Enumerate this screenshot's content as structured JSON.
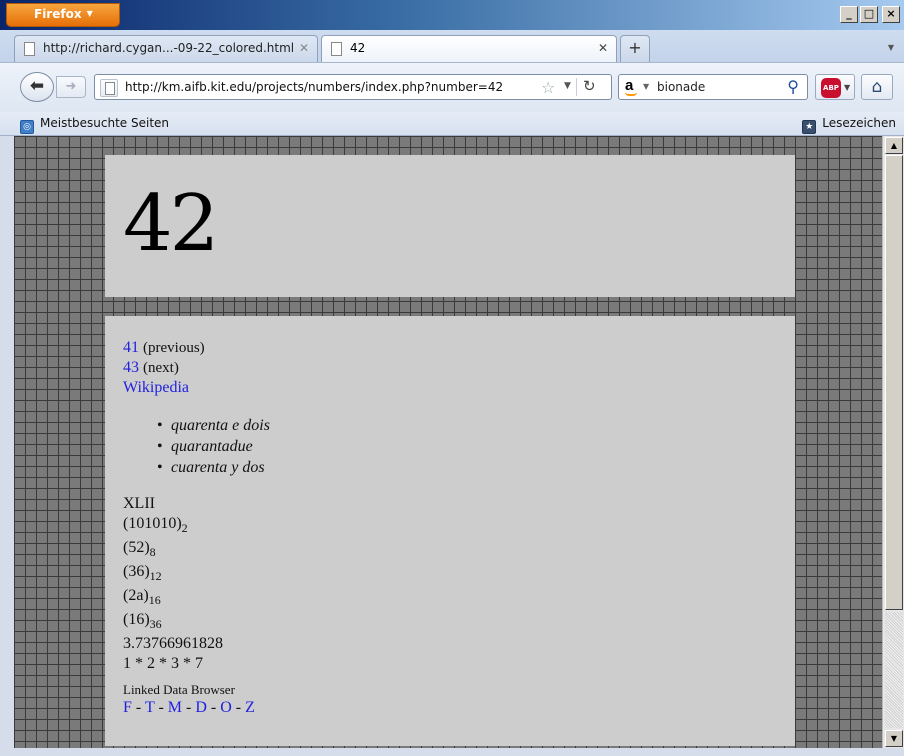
{
  "browser": {
    "menu_button": "Firefox",
    "window_controls": {
      "minimize": "_",
      "maximize": "□",
      "close": "×"
    },
    "tabs": [
      {
        "title": "http://richard.cygan...-09-22_colored.html",
        "active": false
      },
      {
        "title": "42",
        "active": true
      }
    ],
    "new_tab_label": "+",
    "url": "http://km.aifb.kit.edu/projects/numbers/index.php?number=42",
    "search": {
      "engine": "a",
      "query": "bionade"
    },
    "bookmarks_toolbar": {
      "left_item": "Meistbesuchte Seiten",
      "right_item": "Lesezeichen"
    }
  },
  "page": {
    "number": "42",
    "prev": {
      "link": "41",
      "label": "(previous)"
    },
    "next": {
      "link": "43",
      "label": "(next)"
    },
    "wikipedia": "Wikipedia",
    "translations": [
      "quarenta e dois",
      "quarantadue",
      "cuarenta y dos"
    ],
    "roman": "XLII",
    "bases": [
      {
        "value": "(101010)",
        "base": "2"
      },
      {
        "value": "(52)",
        "base": "8"
      },
      {
        "value": "(36)",
        "base": "12"
      },
      {
        "value": "(2a)",
        "base": "16"
      },
      {
        "value": "(16)",
        "base": "36"
      }
    ],
    "sqrt_text": "3.73766961828",
    "factorization": "1 * 2 * 3 * 7",
    "ldb_label": "Linked Data Browser",
    "ldb_links": [
      "F",
      "T",
      "M",
      "D",
      "O",
      "Z"
    ]
  },
  "colors": {
    "link": "#1f1fe0",
    "card": "#cdcdcd",
    "grid_bg": "#7a7a7a",
    "firefox_orange": "#e66f08"
  },
  "icons": {
    "back": "back-arrow-icon",
    "forward": "forward-arrow-icon",
    "bookmark_star": "star-icon",
    "reload": "reload-icon",
    "search": "magnifier-icon",
    "adblock": "adblock-plus-icon",
    "home": "home-icon"
  }
}
